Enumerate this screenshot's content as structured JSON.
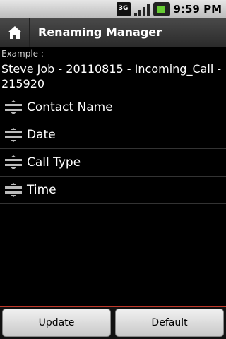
{
  "status_bar": {
    "network_label": "3G",
    "time": "9:59 PM"
  },
  "title_bar": {
    "home_icon": "home-icon",
    "title": "Renaming Manager"
  },
  "example": {
    "label": "Example :",
    "value": "Steve Job - 20110815 - Incoming_Call - 215920"
  },
  "list": {
    "items": [
      {
        "label": "Contact Name",
        "icon": "drag-handle-icon"
      },
      {
        "label": "Date",
        "icon": "drag-handle-icon"
      },
      {
        "label": "Call Type",
        "icon": "drag-handle-icon"
      },
      {
        "label": "Time",
        "icon": "drag-handle-icon"
      }
    ]
  },
  "buttons": {
    "update_label": "Update",
    "default_label": "Default"
  },
  "colors": {
    "accent_line": "#c0392b",
    "background": "#000000"
  }
}
